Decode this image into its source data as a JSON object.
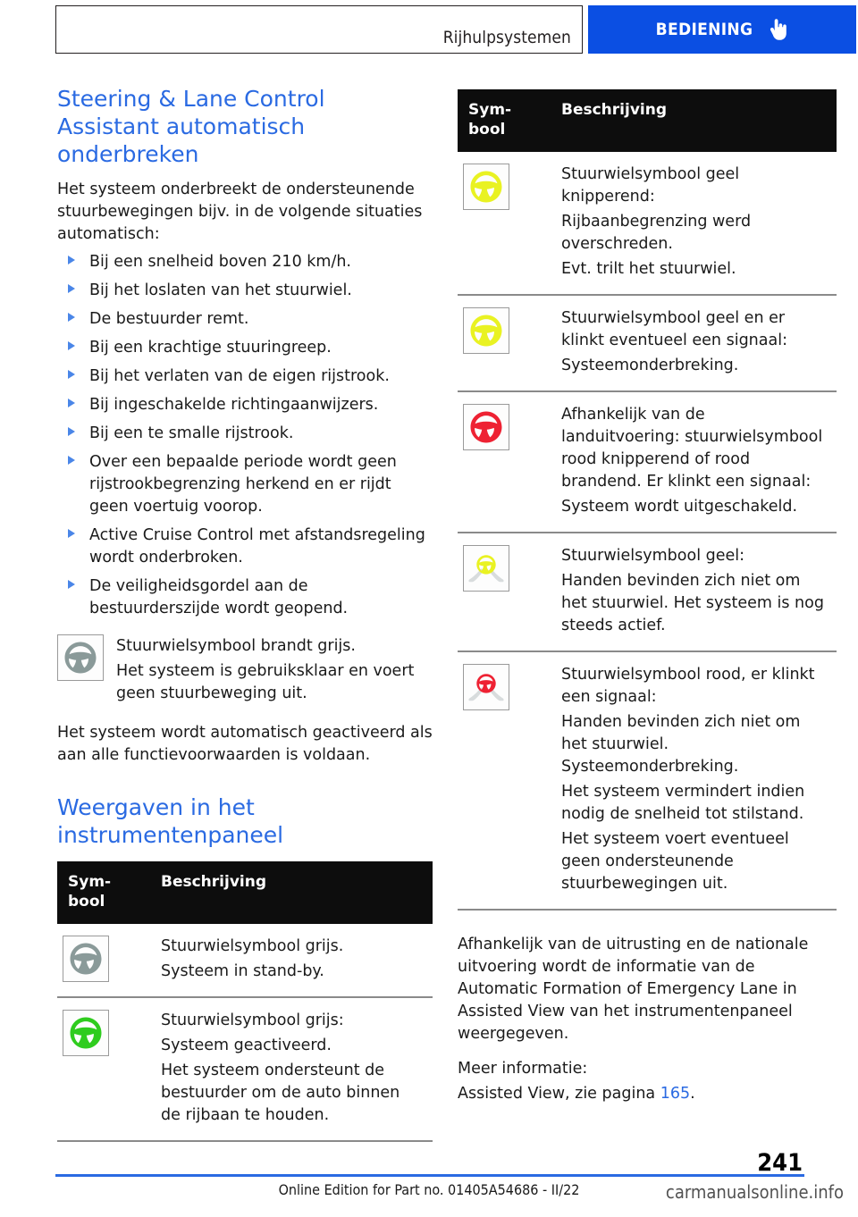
{
  "header": {
    "breadcrumb": "Rijhulpsystemen",
    "tab_label": "BEDIENING",
    "tab_color": "#0b4fe3",
    "hand_icon": "pointing-hand-icon"
  },
  "left_column": {
    "section_title": "Steering & Lane Control Assistant automatisch onderbreken",
    "intro": "Het systeem onderbreekt de ondersteunende stuurbewegingen bijv. in de volgende situaties automatisch:",
    "bullets": [
      "Bij een snelheid boven 210 km/h.",
      "Bij het loslaten van het stuurwiel.",
      "De bestuurder remt.",
      "Bij een krachtige stuuringreep.",
      "Bij het verlaten van de eigen rijstrook.",
      "Bij ingeschakelde richtingaanwijzers.",
      "Bij een te smalle rijstrook.",
      "Over een bepaalde periode wordt geen rijstrookbegrenzing herkend en er rijdt geen voertuig voorop.",
      "Active Cruise Control met afstandsregeling wordt onderbroken.",
      "De veiligheidsgordel aan de bestuurderszijde wordt geopend."
    ],
    "icon_note": {
      "icon": "steering-wheel-grey-icon",
      "icon_color": "#8a9a99",
      "lines": [
        "Stuurwielsymbool brandt grijs.",
        "Het systeem is gebruiksklaar en voert geen stuurbeweging uit."
      ]
    },
    "closing": "Het systeem wordt automatisch geactiveerd als aan alle functievoorwaarden is voldaan.",
    "second_title": "Weergaven in het instrumentenpaneel",
    "table": {
      "headers": [
        "Sym-\nbool",
        "Beschrijving"
      ],
      "header_symbol": "Sym- bool",
      "header_description": "Beschrijving",
      "rows": [
        {
          "icon": "steering-wheel-grey-icon",
          "icon_color": "#8a9a99",
          "icon_style": "wheel",
          "lines": [
            "Stuurwielsymbool grijs.",
            "Systeem in stand-by."
          ]
        },
        {
          "icon": "steering-wheel-green-icon",
          "icon_color": "#2fcc1e",
          "icon_style": "wheel",
          "lines": [
            "Stuurwielsymbool grijs:",
            "Systeem geactiveerd.",
            "Het systeem ondersteunt de bestuurder om de auto binnen de rijbaan te houden."
          ]
        }
      ]
    }
  },
  "right_column": {
    "table": {
      "header_symbol": "Sym- bool",
      "header_description": "Beschrijving",
      "rows": [
        {
          "icon": "steering-wheel-yellow-icon",
          "icon_color": "#e9f222",
          "icon_style": "wheel",
          "lines": [
            "Stuurwielsymbool geel knipperend:",
            "Rijbaanbegrenzing werd overschreden.",
            "Evt. trilt het stuurwiel."
          ]
        },
        {
          "icon": "steering-wheel-yellow-icon",
          "icon_color": "#e9f222",
          "icon_style": "wheel",
          "lines": [
            "Stuurwielsymbool geel en er klinkt eventueel een signaal:",
            "Systeemonderbreking."
          ]
        },
        {
          "icon": "steering-wheel-red-icon",
          "icon_color": "#ee2233",
          "icon_style": "wheel",
          "lines": [
            "Afhankelijk van de landuitvoering: stuurwielsymbool rood knipperend of rood brandend. Er klinkt een signaal:",
            "Systeem wordt uitgeschakeld."
          ]
        },
        {
          "icon": "hands-off-wheel-yellow-icon",
          "icon_color": "#e9f222",
          "icon_style": "hands",
          "lines": [
            "Stuurwielsymbool geel:",
            "Handen bevinden zich niet om het stuurwiel. Het systeem is nog steeds actief."
          ]
        },
        {
          "icon": "hands-off-wheel-red-icon",
          "icon_color": "#ee2233",
          "icon_style": "hands",
          "lines": [
            "Stuurwielsymbool rood, er klinkt een signaal:",
            "Handen bevinden zich niet om het stuurwiel. Systeemonderbreking.",
            "Het systeem vermindert indien nodig de snelheid tot stilstand.",
            "Het systeem voert eventueel geen ondersteunende stuurbewegingen uit."
          ]
        }
      ]
    },
    "tail": {
      "paragraph": "Afhankelijk van de uitrusting en de nationale uitvoering wordt de informatie van de Automatic Formation of Emergency Lane in Assisted View van het instrumentenpaneel weergegeven.",
      "more_info_label": "Meer informatie:",
      "cross_ref_prefix": "Assisted View, zie pagina ",
      "cross_ref_page": "165",
      "cross_ref_suffix": "."
    }
  },
  "footer": {
    "page_number": "241",
    "edition_text": "Online Edition for Part no. 01405A54686 - II/22",
    "watermark": "carmanualsonline.info",
    "rule_color": "#2a6ae2"
  }
}
